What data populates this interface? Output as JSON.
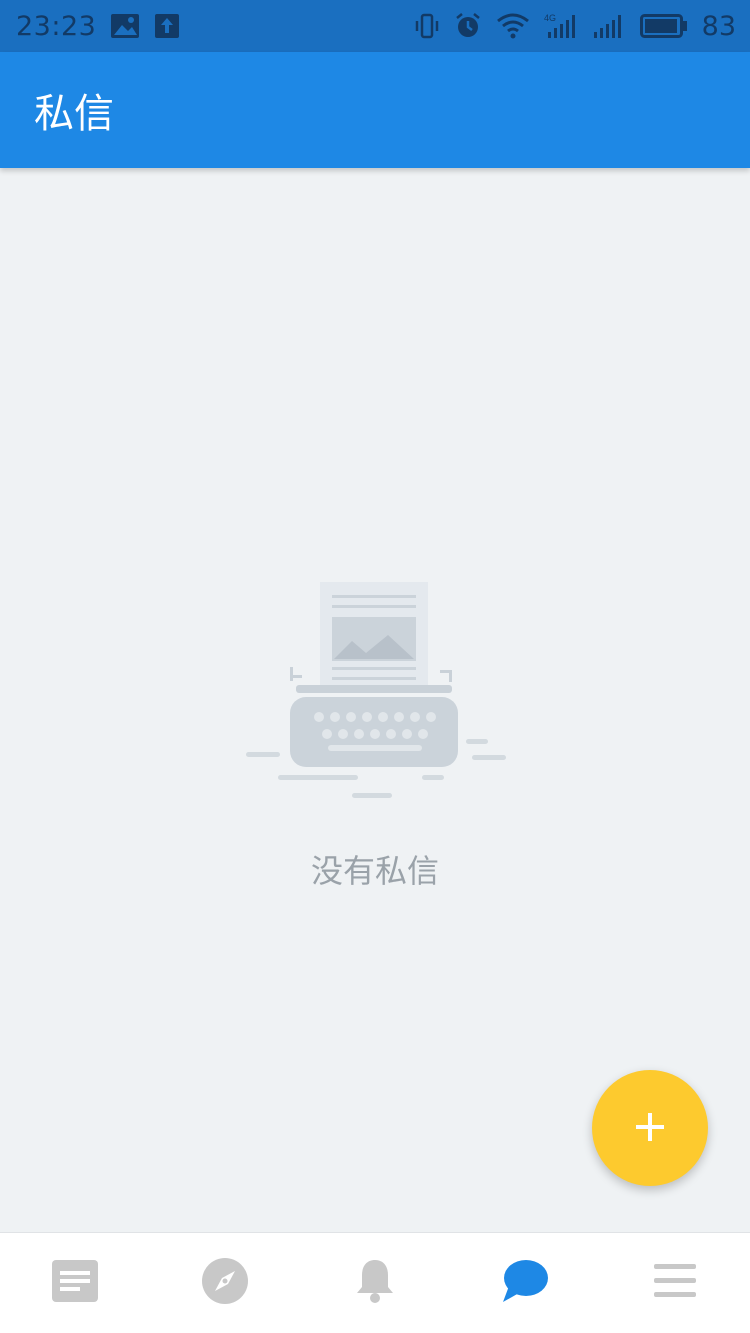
{
  "status_bar": {
    "time": "23:23",
    "battery_percent": "83",
    "icons": [
      "image-icon",
      "upload-icon",
      "vibrate-icon",
      "alarm-icon",
      "wifi-icon",
      "signal-4g-icon",
      "signal-icon",
      "battery-icon"
    ]
  },
  "app_bar": {
    "title": "私信"
  },
  "empty_state": {
    "message": "没有私信",
    "illustration": "typewriter-icon"
  },
  "fab": {
    "icon": "plus-icon"
  },
  "bottom_nav": {
    "items": [
      {
        "icon": "article-icon",
        "active": false
      },
      {
        "icon": "compass-icon",
        "active": false
      },
      {
        "icon": "bell-icon",
        "active": false
      },
      {
        "icon": "chat-icon",
        "active": true
      },
      {
        "icon": "menu-icon",
        "active": false
      }
    ]
  },
  "colors": {
    "status_bar": "#1a6fc0",
    "app_bar": "#1e88e5",
    "background": "#eff2f4",
    "fab": "#fdca2e",
    "nav_active": "#1e88e5",
    "nav_inactive": "#c4c4c4"
  }
}
